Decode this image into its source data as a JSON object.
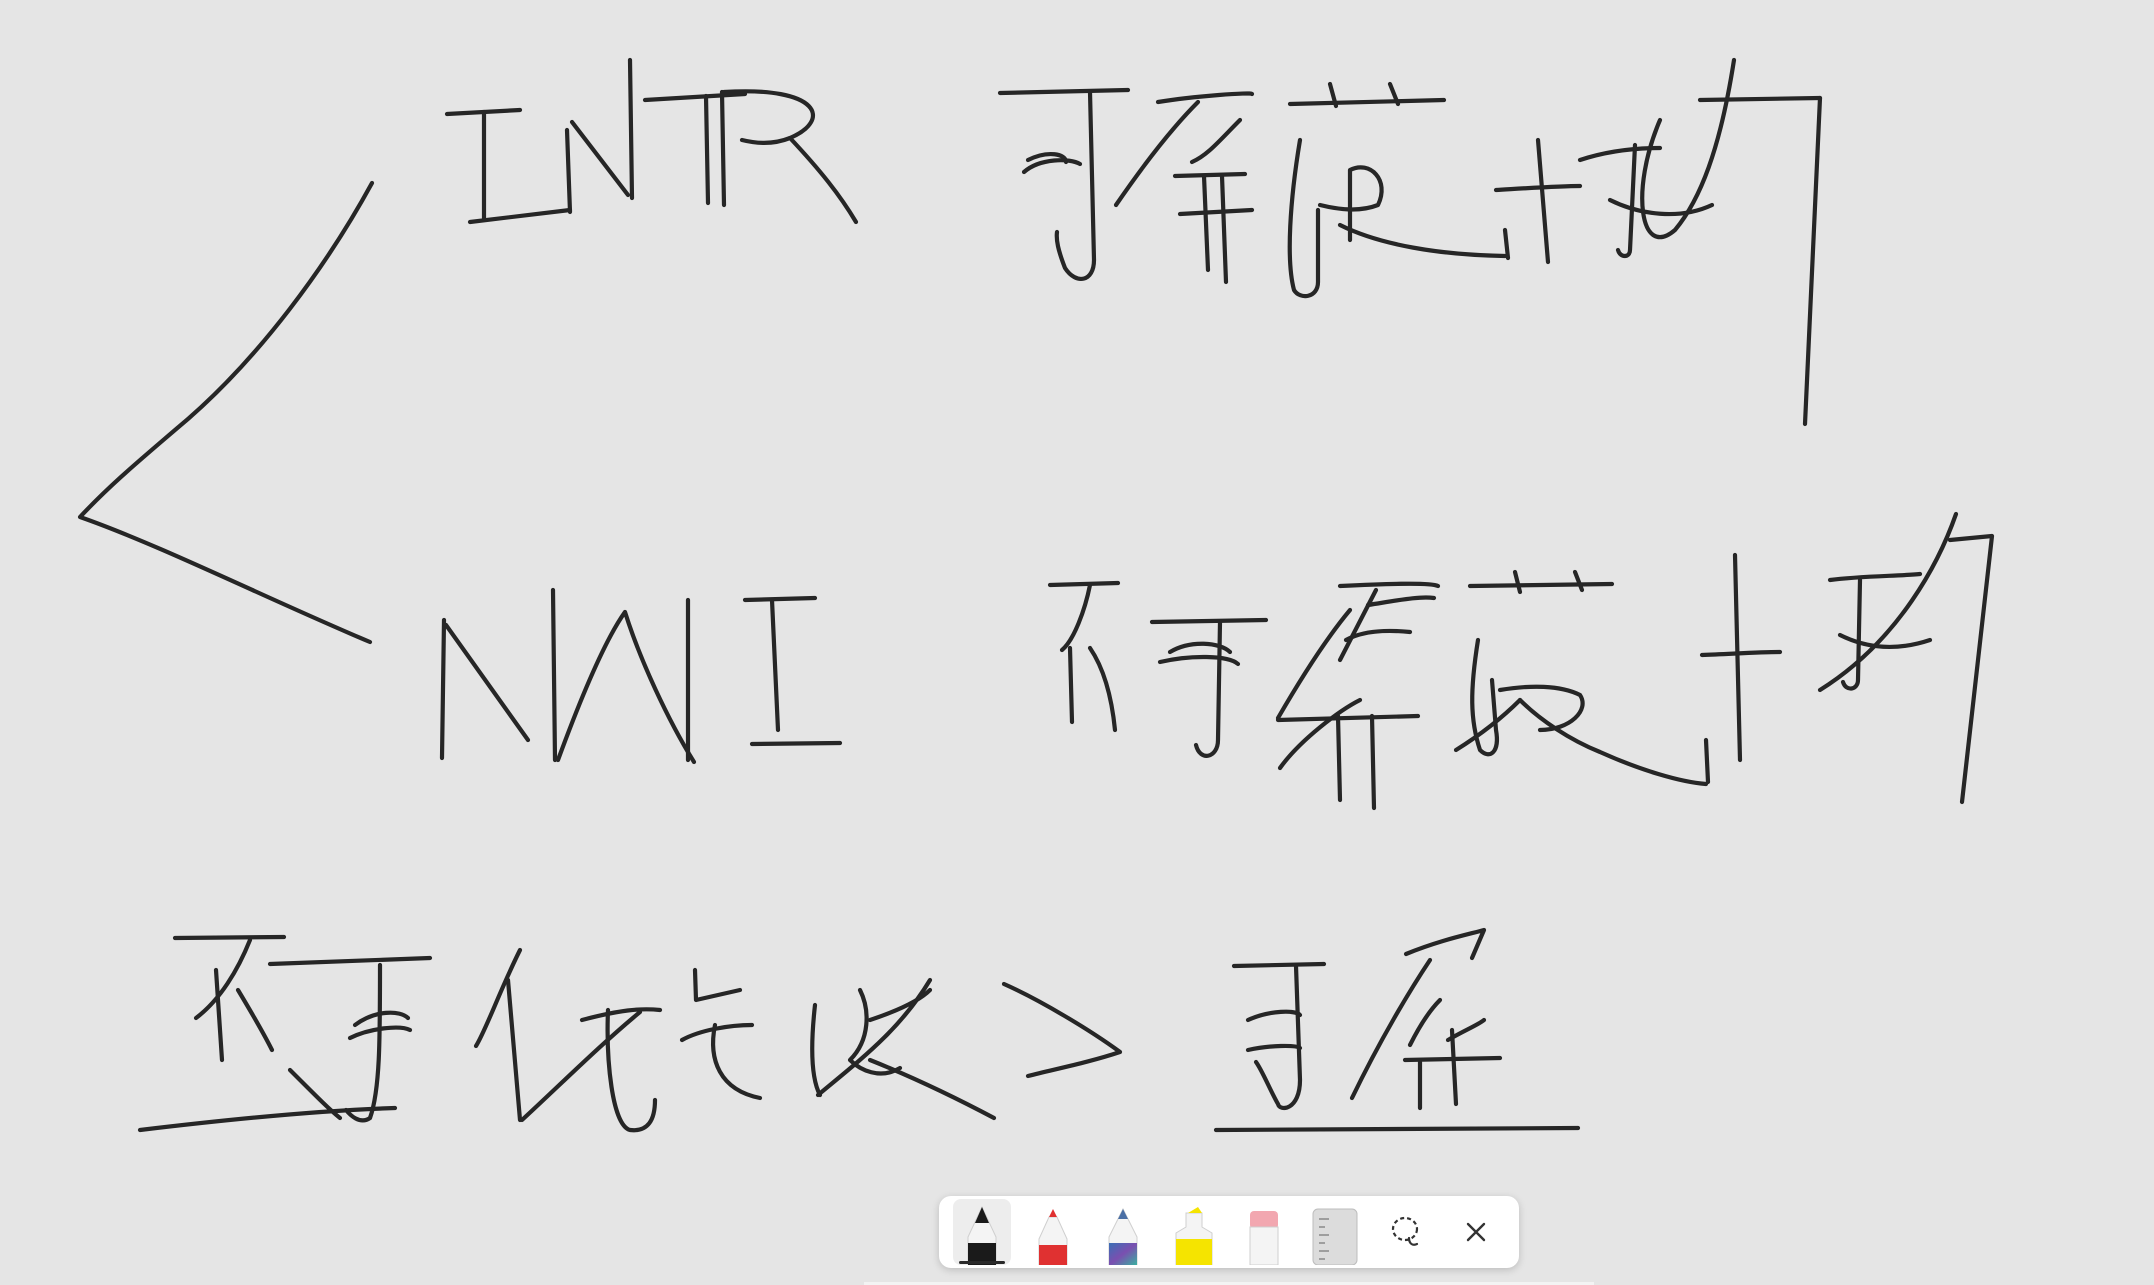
{
  "app": {
    "background_color": "#e5e5e5",
    "ink_color": "#262626"
  },
  "toolbar": {
    "tools": [
      {
        "name": "pen-black",
        "icon": "pen-icon",
        "color": "#1a1a1a",
        "selected": true
      },
      {
        "name": "marker-red",
        "icon": "marker-icon",
        "color": "#e03131",
        "selected": false
      },
      {
        "name": "pencil-multicolor",
        "icon": "pencil-icon",
        "color": "#4a6fa5",
        "selected": false
      },
      {
        "name": "highlighter-yellow",
        "icon": "highlighter-icon",
        "color": "#f5e400",
        "selected": false
      },
      {
        "name": "eraser",
        "icon": "eraser-icon",
        "color": "#f2a7b0",
        "selected": false
      },
      {
        "name": "ruler",
        "icon": "ruler-icon",
        "color": "#d8d8d8",
        "selected": false
      },
      {
        "name": "lasso",
        "icon": "lasso-icon",
        "color": "#333333",
        "selected": false
      },
      {
        "name": "close",
        "icon": "close-icon",
        "color": "#333333",
        "selected": false
      }
    ]
  }
}
